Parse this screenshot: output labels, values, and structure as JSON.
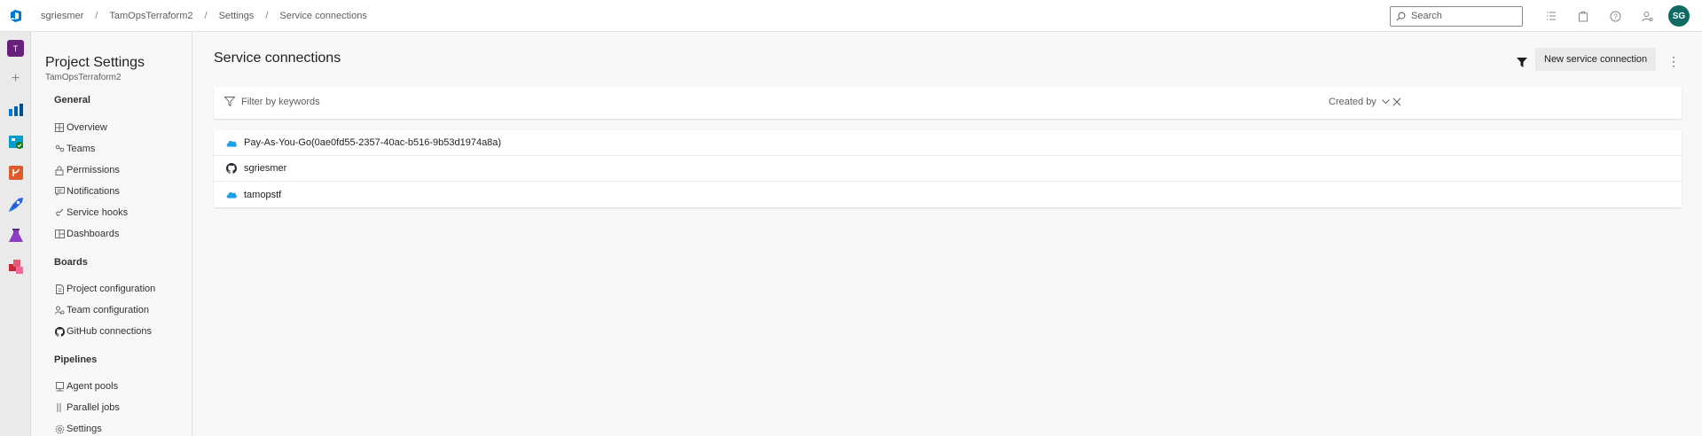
{
  "breadcrumb": [
    "sgriesmer",
    "TamOpsTerraform2",
    "Settings",
    "Service connections"
  ],
  "search": {
    "placeholder": "Search"
  },
  "user": {
    "initials": "SG"
  },
  "project_badge": "T",
  "nav": {
    "title": "Project Settings",
    "project": "TamOpsTerraform2",
    "sections": [
      {
        "label": "General",
        "items": [
          {
            "label": "Overview",
            "icon": "grid-icon"
          },
          {
            "label": "Teams",
            "icon": "teams-icon"
          },
          {
            "label": "Permissions",
            "icon": "lock-icon"
          },
          {
            "label": "Notifications",
            "icon": "chat-icon"
          },
          {
            "label": "Service hooks",
            "icon": "hook-icon"
          },
          {
            "label": "Dashboards",
            "icon": "dashboard-icon"
          }
        ]
      },
      {
        "label": "Boards",
        "items": [
          {
            "label": "Project configuration",
            "icon": "document-icon"
          },
          {
            "label": "Team configuration",
            "icon": "team-config-icon"
          },
          {
            "label": "GitHub connections",
            "icon": "github-icon"
          }
        ]
      },
      {
        "label": "Pipelines",
        "items": [
          {
            "label": "Agent pools",
            "icon": "agent-icon"
          },
          {
            "label": "Parallel jobs",
            "icon": "parallel-icon"
          },
          {
            "label": "Settings",
            "icon": "gear-icon"
          }
        ]
      }
    ]
  },
  "main": {
    "title": "Service connections",
    "new_button": "New service connection",
    "filter_placeholder": "Filter by keywords",
    "created_by": "Created by",
    "connections": [
      {
        "name": "Pay-As-You-Go(0ae0fd55-2357-40ac-b516-9b53d1974a8a)",
        "icon": "azure-cloud-icon"
      },
      {
        "name": "sgriesmer",
        "icon": "github-icon"
      },
      {
        "name": "tamopstf",
        "icon": "azure-cloud-icon"
      }
    ]
  },
  "colors": {
    "azure_cloud": "#1ba1e2",
    "avatar": "#0e6b63",
    "project_badge": "#68217a"
  }
}
